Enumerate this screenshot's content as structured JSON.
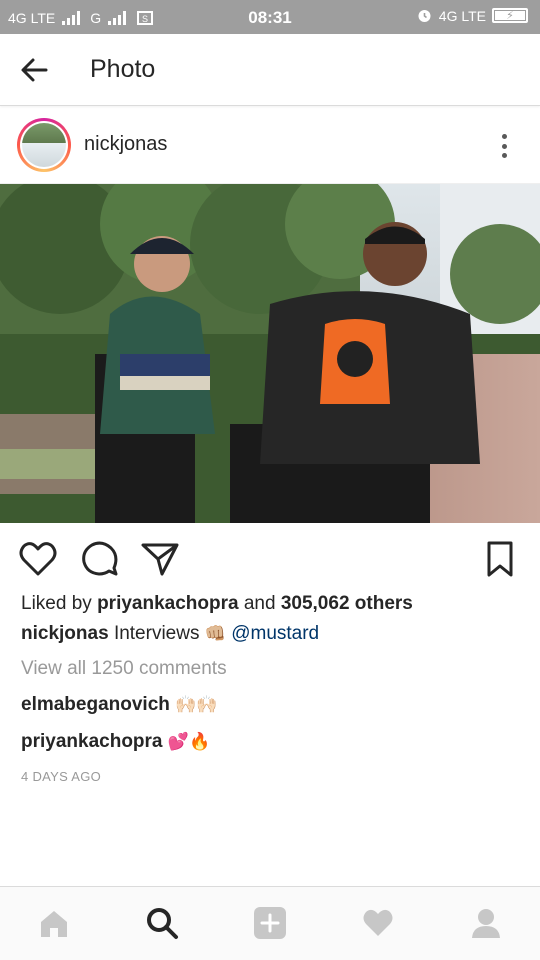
{
  "status_bar": {
    "network_left": "4G LTE",
    "network_second": "G",
    "time": "08:31",
    "network_right": "4G LTE"
  },
  "header": {
    "title": "Photo"
  },
  "post": {
    "username": "nickjonas",
    "liked_by_prefix": "Liked by",
    "liked_by_user": "priyankachopra",
    "liked_by_and": "and",
    "liked_by_count": "305,062 others",
    "caption_user": "nickjonas",
    "caption_text": "Interviews",
    "caption_emoji": "👊🏼",
    "caption_mention": "@mustard",
    "view_comments": "View all 1250 comments",
    "comments": [
      {
        "user": "elmabeganovich",
        "text": "🙌🏻🙌🏻"
      },
      {
        "user": "priyankachopra",
        "text": "💕🔥"
      }
    ],
    "timestamp": "4 DAYS AGO"
  },
  "colors": {
    "accent_link": "#003569",
    "muted": "#999999",
    "text": "#262626",
    "status_bar_bg": "#9e9e9e"
  },
  "icons": {
    "header": [
      "back-arrow-icon"
    ],
    "post": [
      "more-options-icon",
      "heart-icon",
      "comment-icon",
      "share-icon",
      "bookmark-icon"
    ],
    "nav": [
      "home-icon",
      "search-icon",
      "add-post-icon",
      "activity-heart-icon",
      "profile-icon"
    ]
  }
}
